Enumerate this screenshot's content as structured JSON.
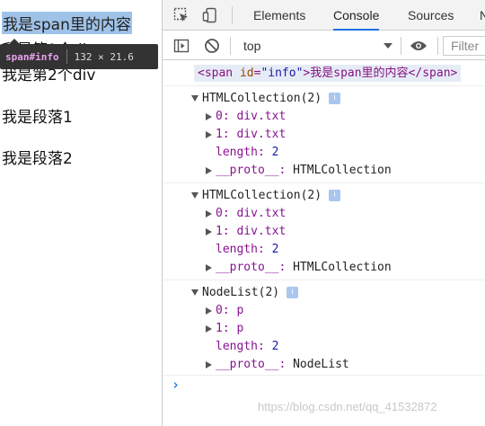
{
  "page": {
    "span_text": "我是span里的内容",
    "div_text_1": "我是第1个div",
    "div_text_2": "我是第2个div",
    "p_text_1": "我是段落1",
    "p_text_2": "我是段落2"
  },
  "tooltip": {
    "tag": "span",
    "id": "#info",
    "dims": "132 × 21.6"
  },
  "devtools": {
    "tabs": [
      {
        "label": "Elements"
      },
      {
        "label": "Console"
      },
      {
        "label": "Sources"
      },
      {
        "label": "N"
      }
    ],
    "active_tab": "Console",
    "context": "top",
    "filter_placeholder": "Filter"
  },
  "console": {
    "span_log": {
      "open_tag": "<span",
      "attr_name": "id",
      "attr_value": "\"info\"",
      "text": ">我是span里的内容</span>"
    },
    "groups": [
      {
        "header": "HTMLCollection(2)",
        "items": [
          {
            "key": "0",
            "value": "div.txt"
          },
          {
            "key": "1",
            "value": "div.txt"
          }
        ],
        "length_label": "length",
        "length_value": "2",
        "proto_label": "__proto__",
        "proto_value": "HTMLCollection"
      },
      {
        "header": "HTMLCollection(2)",
        "items": [
          {
            "key": "0",
            "value": "div.txt"
          },
          {
            "key": "1",
            "value": "div.txt"
          }
        ],
        "length_label": "length",
        "length_value": "2",
        "proto_label": "__proto__",
        "proto_value": "HTMLCollection"
      },
      {
        "header": "NodeList(2)",
        "items": [
          {
            "key": "0",
            "value": "p"
          },
          {
            "key": "1",
            "value": "p"
          }
        ],
        "length_label": "length",
        "length_value": "2",
        "proto_label": "__proto__",
        "proto_value": "NodeList"
      }
    ],
    "prompt": "›"
  },
  "watermark": "https://blog.csdn.net/qq_41532872",
  "colors": {
    "highlight": "#9fc2e8",
    "accent": "#1a73e8",
    "tooltip_bg": "#333333"
  }
}
